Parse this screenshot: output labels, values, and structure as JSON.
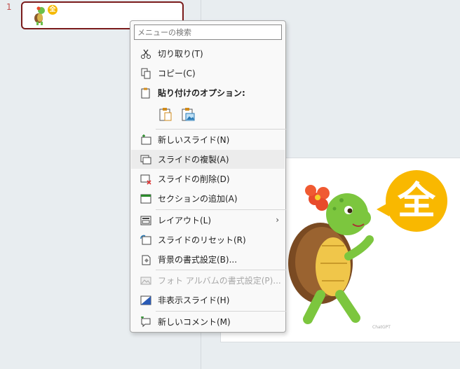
{
  "thumbnail": {
    "slide_number": "1",
    "badge_char": "全"
  },
  "slide": {
    "badge_char": "全",
    "credit": "ChatGPT"
  },
  "menu": {
    "search_placeholder": "メニューの検索",
    "items": [
      {
        "label": "切り取り(T)",
        "icon": "scissors-icon"
      },
      {
        "label": "コピー(C)",
        "icon": "copy-icon"
      },
      {
        "label": "貼り付けのオプション:",
        "icon": "paste-icon"
      },
      {
        "label": "新しいスライド(N)",
        "icon": "new-slide-icon"
      },
      {
        "label": "スライドの複製(A)",
        "icon": "duplicate-slide-icon"
      },
      {
        "label": "スライドの削除(D)",
        "icon": "delete-slide-icon"
      },
      {
        "label": "セクションの追加(A)",
        "icon": "section-icon"
      },
      {
        "label": "レイアウト(L)",
        "icon": "layout-icon"
      },
      {
        "label": "スライドのリセット(R)",
        "icon": "reset-slide-icon"
      },
      {
        "label": "背景の書式設定(B)...",
        "icon": "format-background-icon"
      },
      {
        "label": "フォト アルバムの書式設定(P)...",
        "icon": "photo-album-icon"
      },
      {
        "label": "非表示スライド(H)",
        "icon": "hide-slide-icon"
      },
      {
        "label": "新しいコメント(M)",
        "icon": "new-comment-icon"
      }
    ],
    "paste_options": [
      "paste-keep-source-icon",
      "paste-picture-icon"
    ]
  }
}
